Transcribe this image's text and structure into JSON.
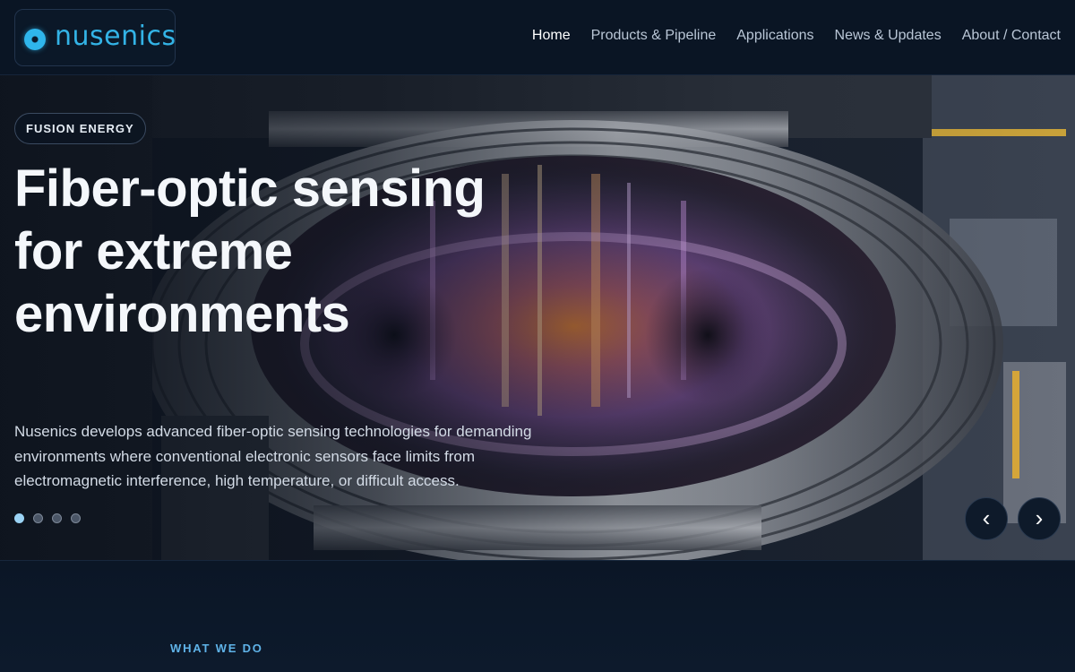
{
  "brand": {
    "name": "nusenics",
    "logo_color": "#33b3e6"
  },
  "nav": {
    "items": [
      {
        "label": "Home",
        "active": true
      },
      {
        "label": "Products & Pipeline",
        "active": false
      },
      {
        "label": "Applications",
        "active": false
      },
      {
        "label": "News & Updates",
        "active": false
      },
      {
        "label": "About / Contact",
        "active": false
      }
    ]
  },
  "hero": {
    "badge": "FUSION ENERGY",
    "headline": "Fiber-optic sensing for extreme environments",
    "description": "Nusenics develops advanced fiber-optic sensing technologies for demanding environments where conventional electronic sensors face limits from electromagnetic interference, high temperature, or difficult access.",
    "slides_total": 4,
    "active_slide": 1,
    "prev_icon": "‹",
    "next_icon": "›",
    "background": "tokamak-reactor-interior-image"
  },
  "section": {
    "eyebrow": "WHAT WE DO"
  },
  "colors": {
    "accent": "#5fb3e8",
    "background": "#0b1626"
  }
}
